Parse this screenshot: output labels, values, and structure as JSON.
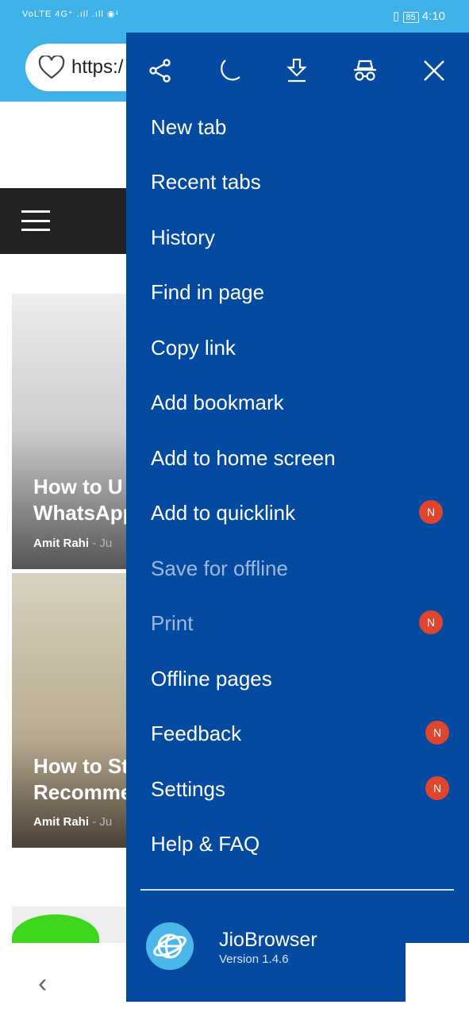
{
  "status": {
    "left": "VoLTE 4G⁺ .ıll .ıll ◉¹",
    "battery": "85",
    "time": "4:10"
  },
  "url": {
    "text": "https:/"
  },
  "articles": [
    {
      "title1": "How to U",
      "title2": "WhatsApp",
      "author": "Amit Rahi",
      "date": "- Ju"
    },
    {
      "title1": "How to St",
      "title2": "Recomme",
      "author": "Amit Rahi",
      "date": "- Ju"
    }
  ],
  "menu": {
    "icons": [
      "share-icon",
      "night-mode-icon",
      "download-icon",
      "incognito-icon",
      "close-icon"
    ],
    "items": [
      {
        "label": "New tab"
      },
      {
        "label": "Recent tabs"
      },
      {
        "label": "History"
      },
      {
        "label": "Find in page"
      },
      {
        "label": "Copy link"
      },
      {
        "label": "Add bookmark"
      },
      {
        "label": "Add to home screen"
      },
      {
        "label": "Add to quicklink",
        "badge": "N"
      },
      {
        "label": "Save for offline",
        "disabled": true
      },
      {
        "label": "Print",
        "badge": "N",
        "disabled": true
      },
      {
        "label": "Offline pages"
      },
      {
        "label": "Feedback",
        "badge": "N"
      },
      {
        "label": "Settings",
        "badge": "N"
      },
      {
        "label": "Help & FAQ"
      }
    ],
    "app_name": "JioBrowser",
    "version": "Version 1.4.6"
  },
  "colors": {
    "menu_bg": "#054aa1",
    "status_bg": "#3db1e8",
    "badge": "#e0452e"
  }
}
